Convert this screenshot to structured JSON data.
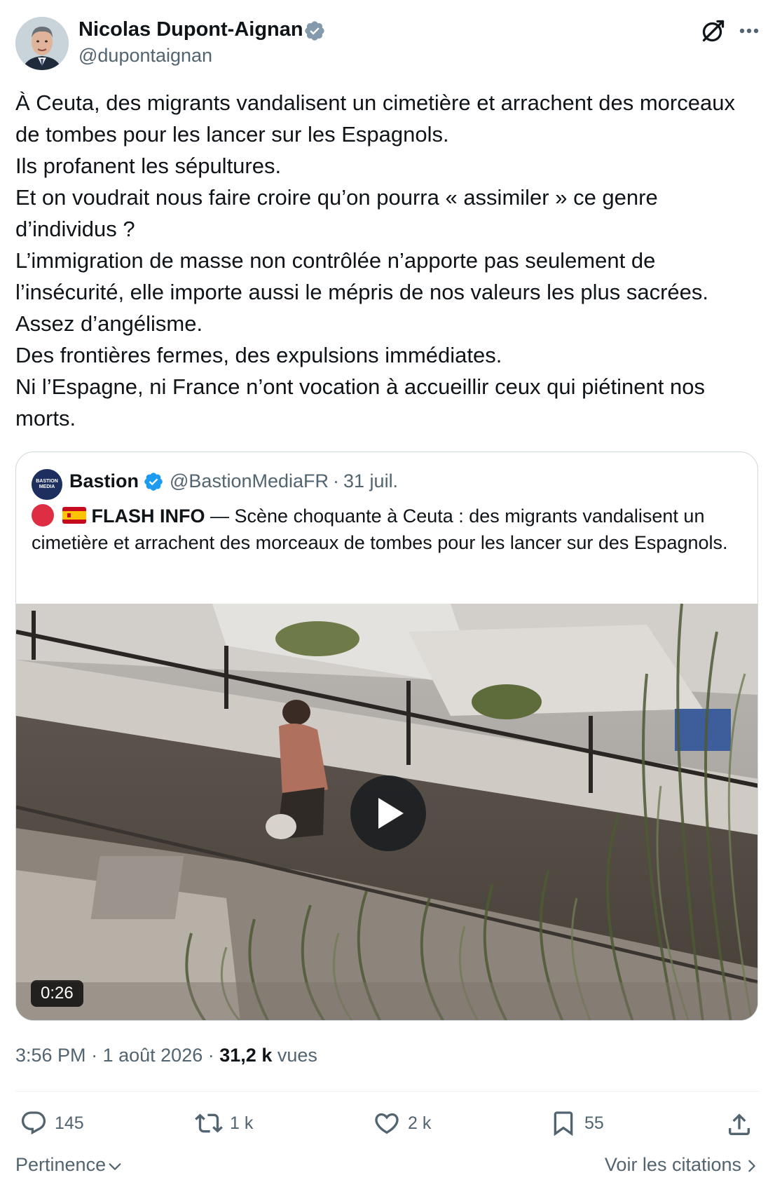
{
  "author": {
    "name": "Nicolas Dupont-Aignan",
    "handle": "@dupontaignan"
  },
  "tweet": {
    "lines": [
      "À Ceuta, des migrants vandalisent un cimetière et arrachent des morceaux de tombes pour les lancer sur les Espagnols.",
      "Ils profanent les sépultures.",
      "Et on voudrait nous faire croire qu’on pourra « assimiler » ce genre d’individus ?",
      "L’immigration de masse non contrôlée n’apporte pas seulement de l’insécurité, elle importe aussi le mépris de nos valeurs les plus sacrées.",
      "Assez d’angélisme.",
      "Des frontières fermes, des expulsions immédiates.",
      "Ni l’Espagne, ni France n’ont vocation à accueillir ceux qui piétinent nos morts."
    ]
  },
  "quote": {
    "avatar_text": "BASTION MEDIA",
    "name": "Bastion",
    "handle": "@BastionMediaFR",
    "separator": "·",
    "date": "31 juil.",
    "flash_label": "FLASH INFO",
    "text": " — Scène choquante à Ceuta : des migrants vandalisent un cimetière et arrachent des morceaux de tombes pour les lancer sur des Espagnols.",
    "video_duration": "0:26"
  },
  "meta": {
    "time": "3:56 PM",
    "separator": "·",
    "date": "1 août 2026",
    "views_count": "31,2 k",
    "views_label": "vues"
  },
  "actions": {
    "replies": "145",
    "reposts": "1 k",
    "likes": "2 k",
    "bookmarks": "55"
  },
  "footer": {
    "sort_label": "Pertinence",
    "quotes_link": "Voir les citations"
  },
  "colors": {
    "text_primary": "#0f1419",
    "text_secondary": "#536471",
    "verified_blue": "#1d9bf0",
    "verified_grey": "#829aab",
    "border": "#cfd9de"
  },
  "icons": {
    "verified_author": "verified-badge-grey-icon",
    "verified_quote": "verified-badge-blue-icon",
    "grok": "grok-icon",
    "more": "more-dots-icon",
    "reply": "reply-bubble-icon",
    "repost": "repost-arrows-icon",
    "like": "heart-icon",
    "bookmark": "bookmark-icon",
    "share": "share-upload-icon",
    "play": "play-icon"
  }
}
